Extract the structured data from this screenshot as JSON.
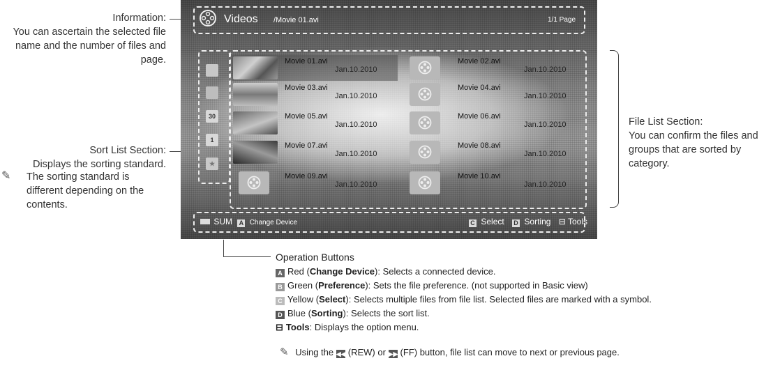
{
  "callouts": {
    "information": {
      "title": "Information:",
      "body": "You can ascertain the selected file name and the number of files and page."
    },
    "sort_list": {
      "title": "Sort List Section:",
      "body": "Displays the sorting standard."
    },
    "sort_note": "The sorting standard is different depending on the contents.",
    "file_list": {
      "title": "File List Section:",
      "body": "You can confirm the files and groups that are sorted by category."
    }
  },
  "screen": {
    "title": "Videos",
    "path": "/Movie 01.avi",
    "page": "1/1 Page",
    "sort_icons": [
      "",
      "",
      "30",
      "1",
      ""
    ],
    "files": [
      {
        "name": "Movie 01.avi",
        "date": "Jan.10.2010"
      },
      {
        "name": "Movie 02.avi",
        "date": "Jan.10.2010"
      },
      {
        "name": "Movie 03.avi",
        "date": "Jan.10.2010"
      },
      {
        "name": "Movie 04.avi",
        "date": "Jan.10.2010"
      },
      {
        "name": "Movie 05.avi",
        "date": "Jan.10.2010"
      },
      {
        "name": "Movie 06.avi",
        "date": "Jan.10.2010"
      },
      {
        "name": "Movie 07.avi",
        "date": "Jan.10.2010"
      },
      {
        "name": "Movie 08.avi",
        "date": "Jan.10.2010"
      },
      {
        "name": "Movie 09.avi",
        "date": "Jan.10.2010"
      },
      {
        "name": "Movie 10.avi",
        "date": "Jan.10.2010"
      }
    ],
    "bottom": {
      "sum": "SUM",
      "a_key": "A",
      "change_device": "Change Device",
      "c_key": "C",
      "select": "Select",
      "d_key": "D",
      "sorting": "Sorting",
      "tools": "Tools"
    }
  },
  "operation": {
    "heading": "Operation Buttons",
    "items": [
      {
        "key": "A",
        "color": "Red",
        "name": "Change Device",
        "desc": ": Selects a connected device."
      },
      {
        "key": "B",
        "color": "Green",
        "name": "Preference",
        "desc": ": Sets the file preference. (not supported in Basic view)"
      },
      {
        "key": "C",
        "color": "Yellow",
        "name": "Select",
        "desc": ": Selects multiple files from file list. Selected files are marked with a symbol."
      },
      {
        "key": "D",
        "color": "Blue",
        "name": "Sorting",
        "desc": ": Selects the sort list."
      }
    ],
    "tools": {
      "name": "Tools",
      "desc": ": Displays the option menu."
    },
    "note": {
      "pre": "Using the",
      "rew": "(REW) or",
      "ff": "(FF) button, file list can move to next or previous page."
    }
  }
}
